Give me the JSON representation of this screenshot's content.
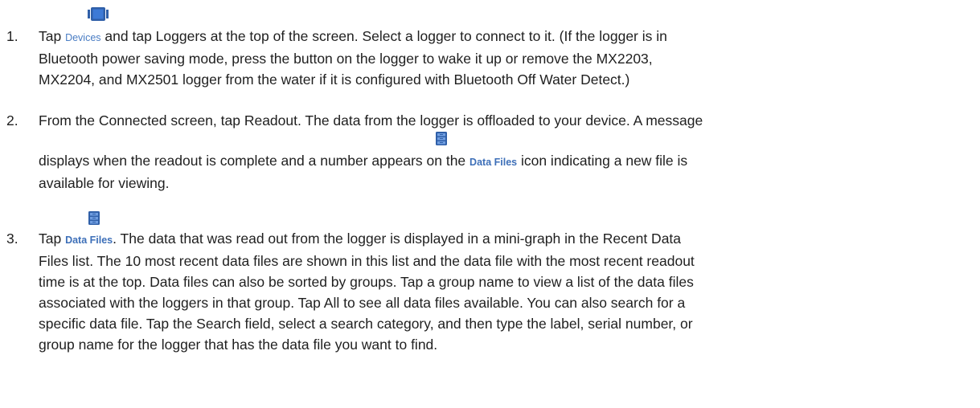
{
  "steps": [
    {
      "number": "1.",
      "lines": [
        [
          "Tap ",
          "{Devices}",
          " and tap Loggers at the top of the screen. Select a logger to connect to it. (If the logger is in"
        ],
        [
          "Bluetooth power saving mode, press the button on the logger to wake it up or remove the MX2203,"
        ],
        [
          "MX2204, and MX2501 logger from the water if it is configured with Bluetooth Off Water Detect.)"
        ]
      ],
      "icon": "devices-icon",
      "inline_label": "Devices"
    },
    {
      "number": "2.",
      "lines": [
        [
          "From the Connected screen, tap Readout. The data from the logger is offloaded to your device. A message"
        ],
        [
          "displays when the readout is complete and a number appears on the ",
          "{Data Files}",
          " icon indicating a new file is"
        ],
        [
          "available for viewing."
        ]
      ],
      "icon": "data-files-icon",
      "inline_label": "Data Files"
    },
    {
      "number": "3.",
      "lines": [
        [
          "Tap ",
          "{Data Files}",
          ". The data that was read out from the logger is displayed in a mini-graph in the Recent Data"
        ],
        [
          "Files list. The 10 most recent data files are shown in this list and the data file with the most recent readout"
        ],
        [
          "time is at the top. Data files can also be sorted by groups. Tap a group name to view a list of the data files"
        ],
        [
          "associated with the loggers in that group. Tap All to see all data files available. You can also search for a"
        ],
        [
          "specific data file. Tap the Search field, select a search category, and then type the label, serial number, or"
        ],
        [
          "group name for the logger that has the data file you want to find."
        ]
      ],
      "icon": "data-files-icon",
      "inline_label": "Data Files"
    }
  ],
  "colors": {
    "text": "#1f1f1f",
    "icon_blue": "#2f5fa8",
    "label_blue": "#4a7dc4"
  }
}
